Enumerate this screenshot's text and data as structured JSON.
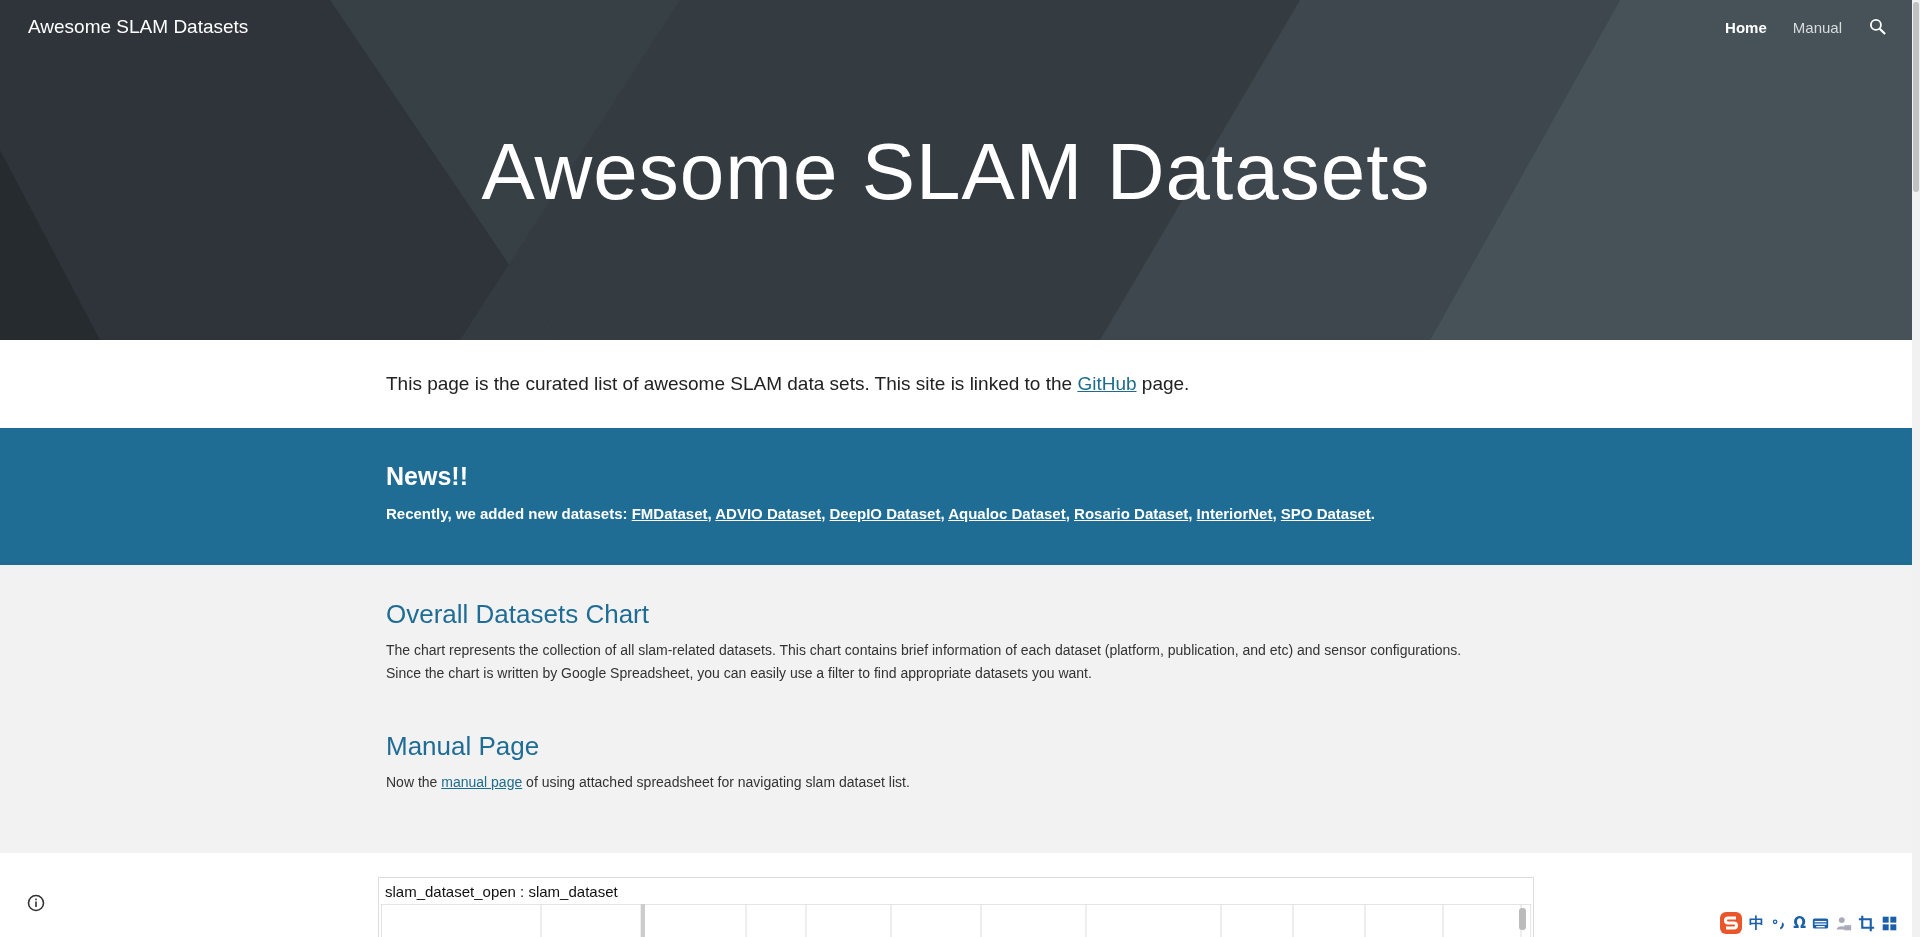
{
  "site_title": "Awesome SLAM Datasets",
  "nav": [
    {
      "label": "Home",
      "selected": true
    },
    {
      "label": "Manual",
      "selected": false
    }
  ],
  "hero_title": "Awesome SLAM Datasets",
  "intro": {
    "before": "This page is the curated list of awesome SLAM data sets. This site is linked to the ",
    "link": "GitHub",
    "after": " page."
  },
  "news": {
    "heading": "News!!",
    "lead": "Recently, we added new datasets: ",
    "links": [
      "FMDataset",
      "ADVIO Dataset",
      "DeepIO Dataset",
      "Aqualoc Dataset",
      "Rosario Dataset",
      "InteriorNet",
      "SPO Dataset"
    ],
    "separator": ", ",
    "end": "."
  },
  "chart_section": {
    "heading": "Overall Datasets Chart",
    "lines": [
      "The chart represents the collection of all slam-related datasets. This chart contains brief information of each dataset (platform, publication, and etc) and sensor configurations.",
      "Since the chart is written by Google Spreadsheet, you can easily use a filter to find appropriate datasets you want."
    ]
  },
  "manual_section": {
    "heading": "Manual Page",
    "before": "Now the ",
    "link": "manual page",
    "after": " of using attached spreadsheet for navigating slam dataset list."
  },
  "spreadsheet": {
    "title": "slam_dataset_open : slam_dataset"
  },
  "ime": {
    "mode": "中",
    "symbol": "Ω"
  }
}
